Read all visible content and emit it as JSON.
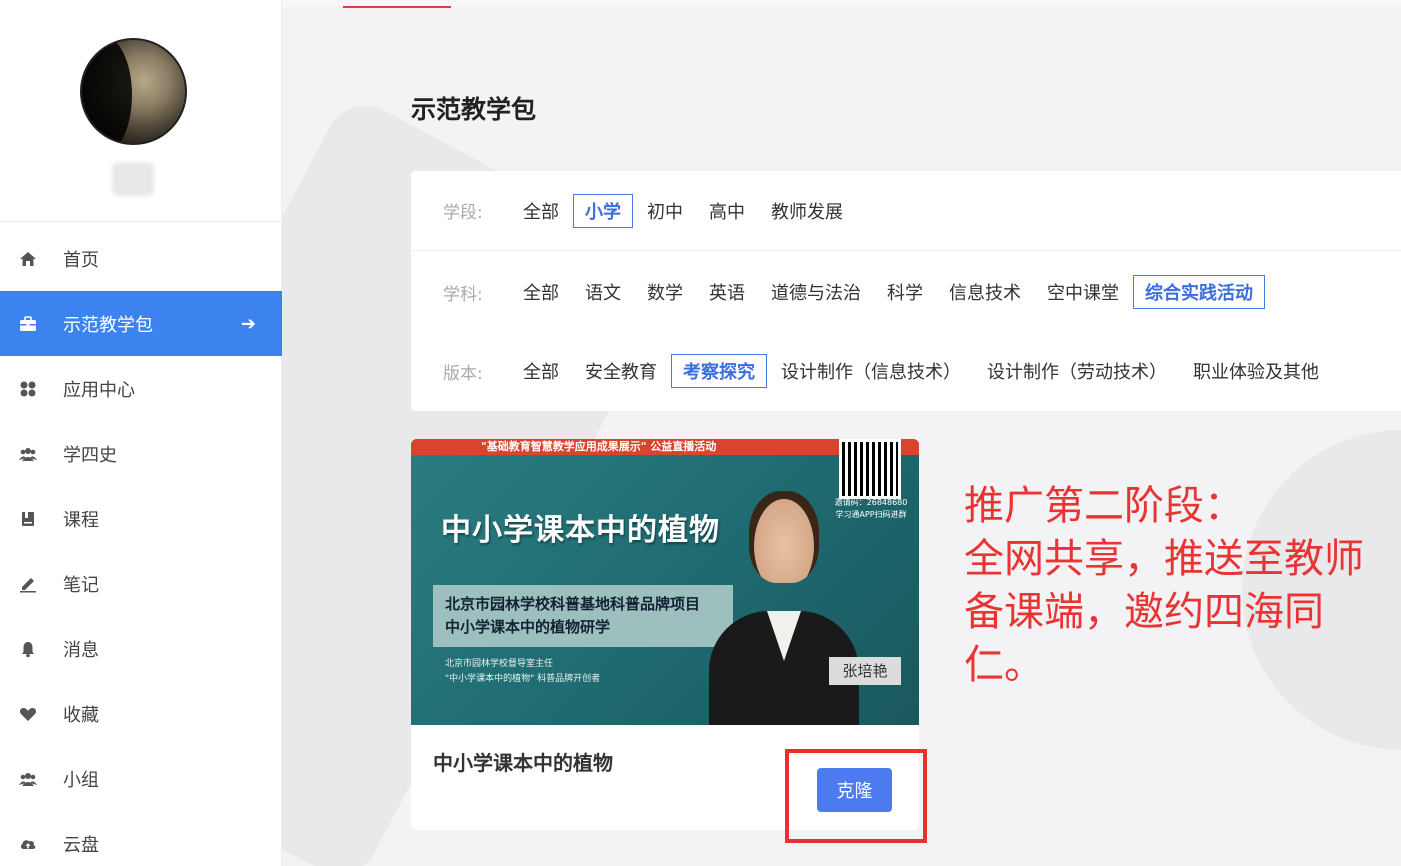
{
  "sidebar": {
    "items": [
      {
        "label": "首页",
        "icon": "home-icon",
        "active": false
      },
      {
        "label": "示范教学包",
        "icon": "briefcase-icon",
        "active": true
      },
      {
        "label": "应用中心",
        "icon": "apps-icon",
        "active": false
      },
      {
        "label": "学四史",
        "icon": "group-icon",
        "active": false
      },
      {
        "label": "课程",
        "icon": "book-icon",
        "active": false
      },
      {
        "label": "笔记",
        "icon": "pen-icon",
        "active": false
      },
      {
        "label": "消息",
        "icon": "bell-icon",
        "active": false
      },
      {
        "label": "收藏",
        "icon": "heart-icon",
        "active": false
      },
      {
        "label": "小组",
        "icon": "group-icon",
        "active": false
      },
      {
        "label": "云盘",
        "icon": "cloud-upload-icon",
        "active": false
      }
    ]
  },
  "main": {
    "title": "示范教学包",
    "filters": {
      "stage": {
        "label": "学段:",
        "options": [
          "全部",
          "小学",
          "初中",
          "高中",
          "教师发展"
        ],
        "selected": "小学"
      },
      "subject": {
        "label": "学科:",
        "options": [
          "全部",
          "语文",
          "数学",
          "英语",
          "道德与法治",
          "科学",
          "信息技术",
          "空中课堂",
          "综合实践活动"
        ],
        "selected": "综合实践活动"
      },
      "edition": {
        "label": "版本:",
        "options": [
          "全部",
          "安全教育",
          "考察探究",
          "设计制作（信息技术）",
          "设计制作（劳动技术）",
          "职业体验及其他"
        ],
        "selected": "考察探究"
      }
    },
    "card": {
      "cover": {
        "banner": "\"基础教育智慧教学应用成果展示\" 公益直播活动",
        "title": "中小学课本中的植物",
        "box_line1": "北京市园林学校科普基地科普品牌项目",
        "box_line2": "中小学课本中的植物研学",
        "small_line1": "北京市园林学校督导室主任",
        "small_line2": "\"中小学课本中的植物\" 科普品牌开创者",
        "qr_line1": "邀请码：26848680",
        "qr_line2": "学习通APP扫码进群",
        "speaker": "张培艳"
      },
      "title": "中小学课本中的植物",
      "clone_label": "克隆"
    }
  },
  "annotation": {
    "line1": "推广第二阶段：",
    "line2": "全网共享，推送至教师",
    "line3": "备课端，邀约四海同",
    "line4": "仁。"
  },
  "colors": {
    "accent": "#3d83f0",
    "selected_border": "#4478e5",
    "annotation_red": "#ea3433",
    "button_blue": "#4c7bf0"
  }
}
